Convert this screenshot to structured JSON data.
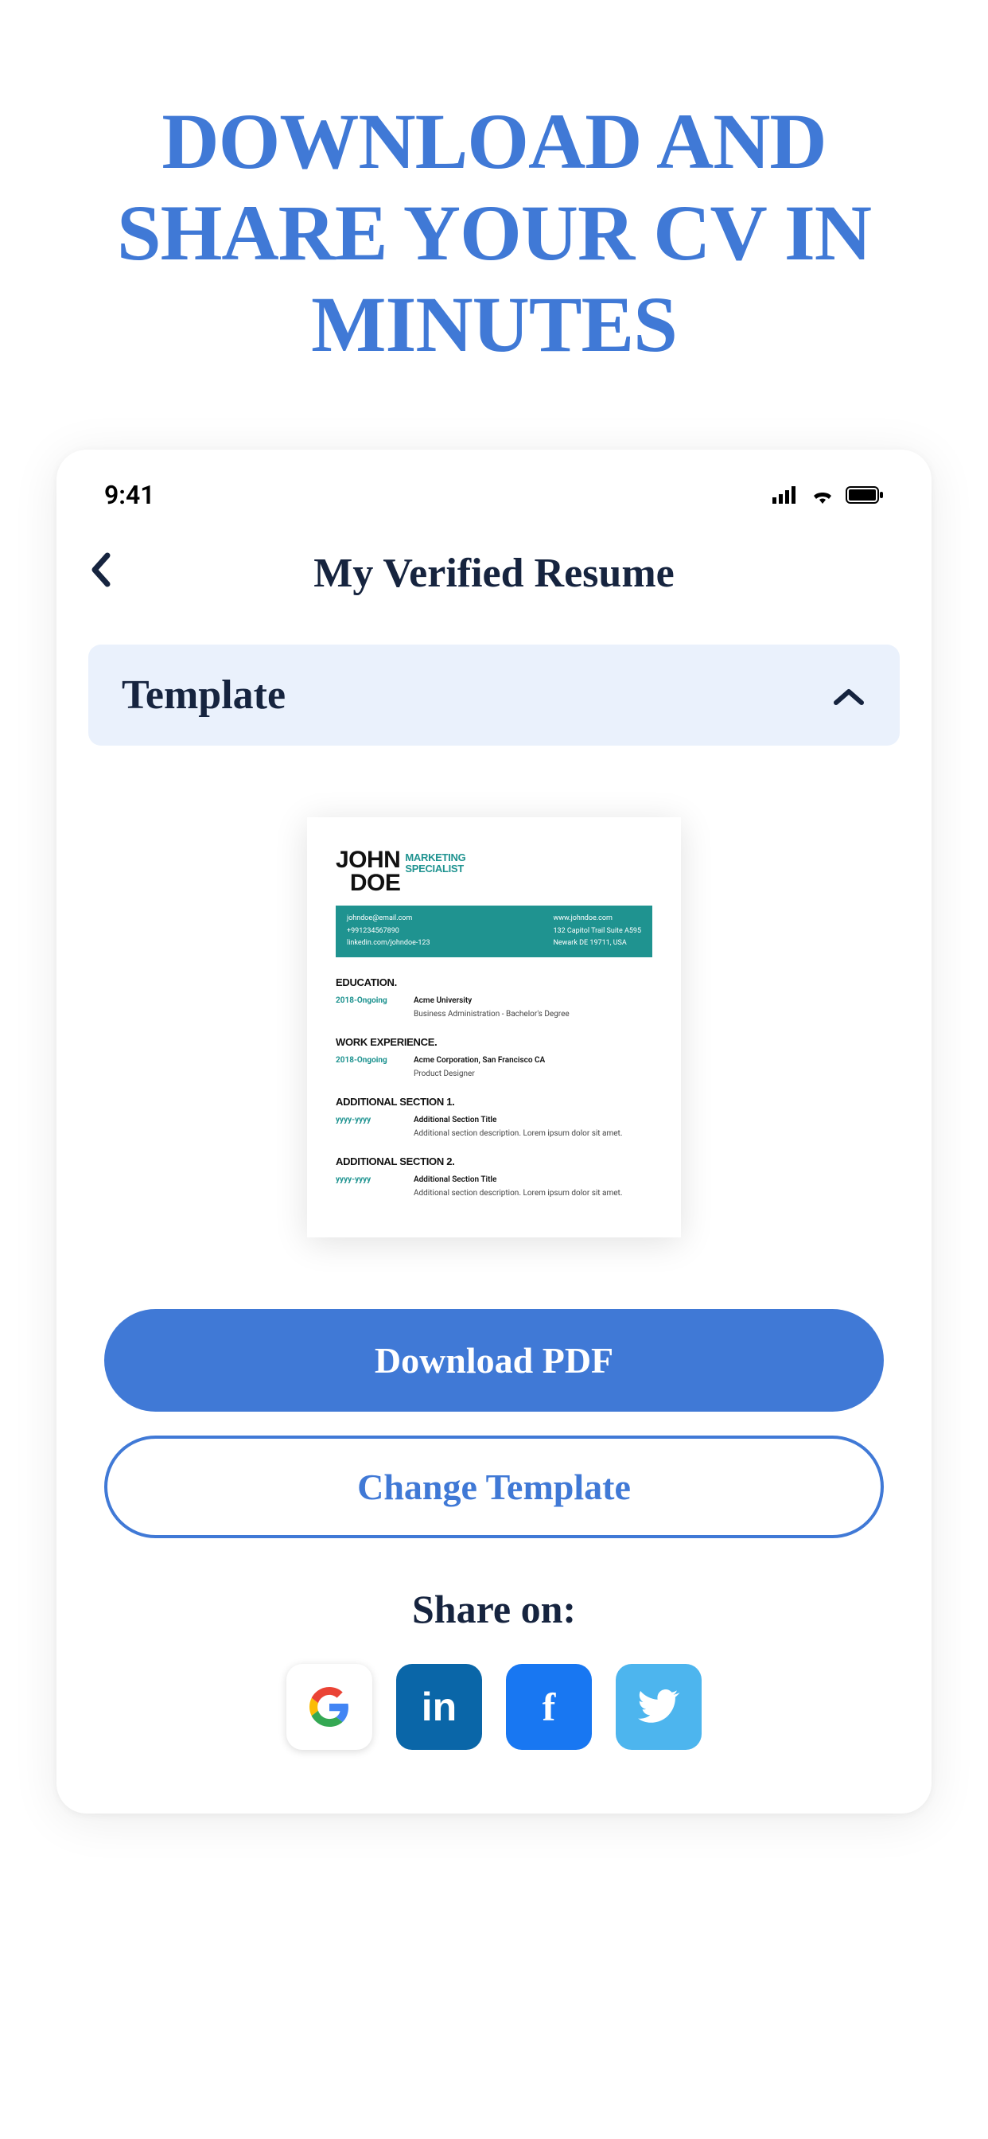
{
  "hero": "DOWNLOAD AND SHARE YOUR CV IN MINUTES",
  "status": {
    "time": "9:41"
  },
  "screen": {
    "title": "My Verified Resume",
    "template_label": "Template"
  },
  "resume": {
    "name_first": "JOHN",
    "name_last": "DOE",
    "role1": "MARKETING",
    "role2": "SPECIALIST",
    "contact_left": [
      "johndoe@email.com",
      "+991234567890",
      "linkedin.com/johndoe-123"
    ],
    "contact_right": [
      "www.johndoe.com",
      "132 Capitol Trail Suite A595",
      "Newark DE 19711, USA"
    ],
    "sections": [
      {
        "title": "EDUCATION.",
        "date": "2018-Ongoing",
        "main": "Acme University",
        "sub": "Business Administration - Bachelor's Degree"
      },
      {
        "title": "WORK EXPERIENCE.",
        "date": "2018-Ongoing",
        "main": "Acme Corporation, San Francisco CA",
        "sub": "Product Designer"
      },
      {
        "title": "ADDITIONAL SECTION 1.",
        "date": "yyyy-yyyy",
        "main": "Additional Section Title",
        "sub": "Additional section description. Lorem ipsum dolor sit amet."
      },
      {
        "title": "ADDITIONAL SECTION 2.",
        "date": "yyyy-yyyy",
        "main": "Additional Section Title",
        "sub": "Additional section description. Lorem ipsum dolor sit amet."
      }
    ]
  },
  "buttons": {
    "download": "Download PDF",
    "change": "Change Template"
  },
  "share": {
    "title": "Share on:"
  }
}
